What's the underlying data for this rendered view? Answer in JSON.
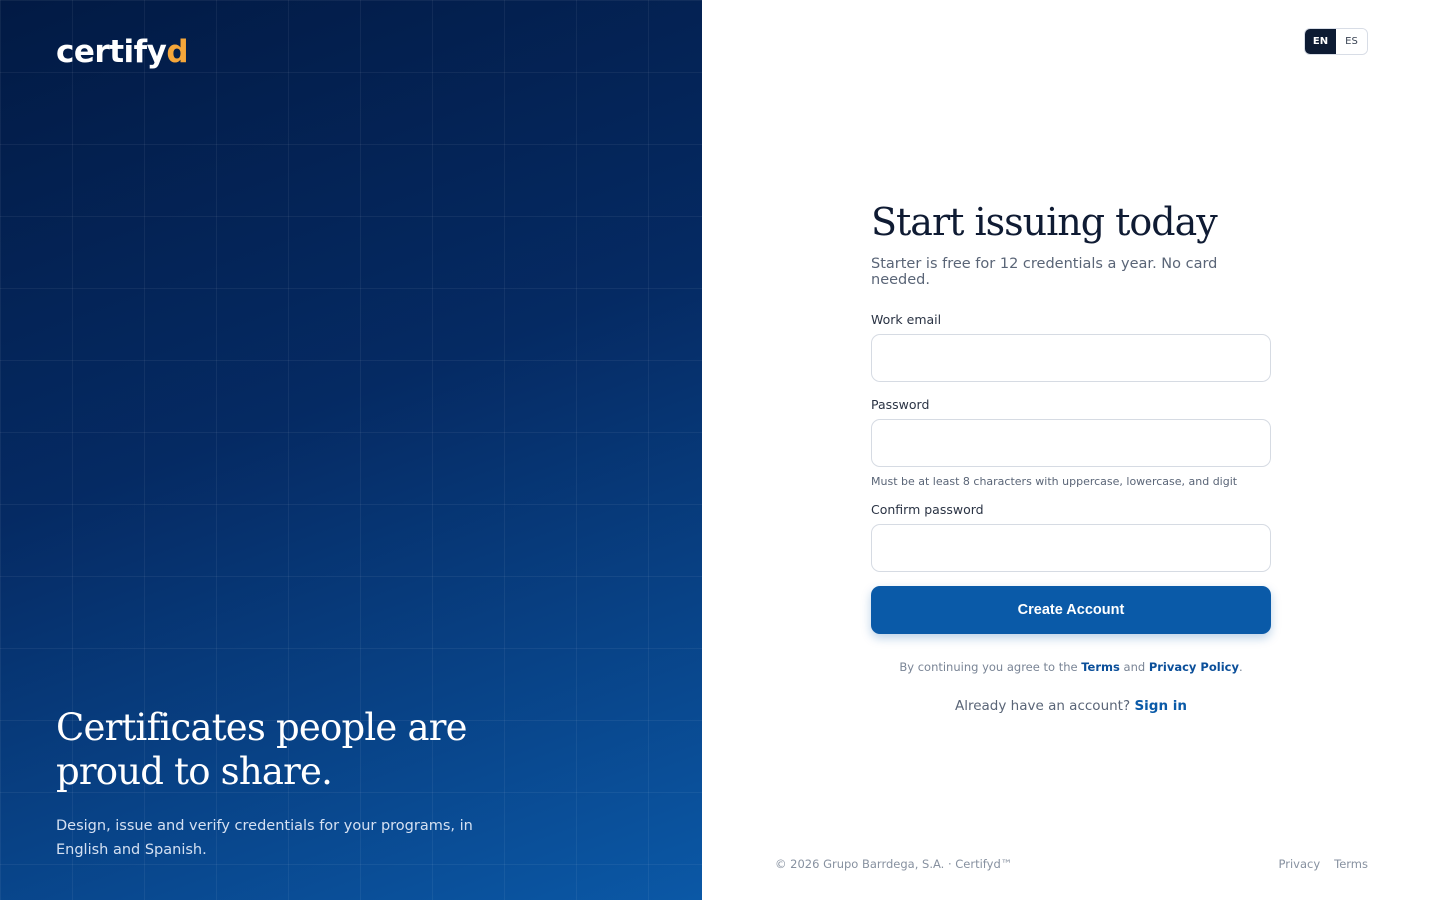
{
  "brand": {
    "logo_main": "certify",
    "logo_accent": "d",
    "accent_color": "#f5a63a",
    "primary_color": "#0a5aa8"
  },
  "hero": {
    "title": "Certificates people are proud to share.",
    "subtitle": "Design, issue and verify credentials for your programs, in English and Spanish."
  },
  "language": {
    "options": [
      "EN",
      "ES"
    ],
    "selected": "EN"
  },
  "form": {
    "title": "Start issuing today",
    "subtitle": "Starter is free for 12 credentials a year. No card needed.",
    "email_label": "Work email",
    "email_value": "",
    "password_label": "Password",
    "password_value": "",
    "password_hint": "Must be at least 8 characters with uppercase, lowercase, and digit",
    "confirm_label": "Confirm password",
    "confirm_value": "",
    "submit_label": "Create Account",
    "terms_prefix": "By continuing you agree to the",
    "terms_link": "Terms",
    "terms_and": "and",
    "privacy_link": "Privacy Policy",
    "terms_suffix": ".",
    "signin_prefix": "Already have an account?",
    "signin_link": "Sign in"
  },
  "footer": {
    "copyright": "© 2026 Grupo Barrdega, S.A. · Certifyd™",
    "links": [
      "Privacy",
      "Terms"
    ]
  }
}
